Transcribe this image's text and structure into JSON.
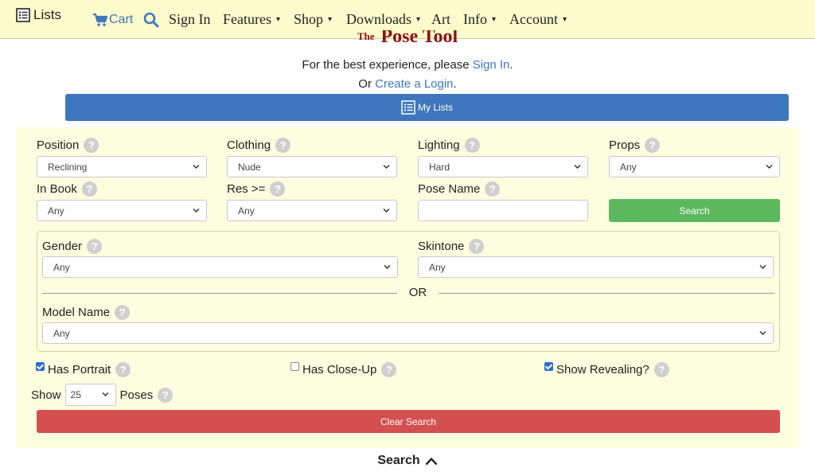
{
  "nav": {
    "lists_label": "Lists",
    "cart_label": "Cart",
    "signin_label": "Sign In",
    "features_label": "Features",
    "shop_label": "Shop",
    "downloads_label": "Downloads",
    "art_label": "Art",
    "info_label": "Info",
    "account_label": "Account",
    "caret": "▾"
  },
  "header": {
    "logo_prefix": "The",
    "logo_title": "Pose Tool",
    "signin_prefix": "For the best experience, please ",
    "signin_link": "Sign In",
    "signin_suffix": ".",
    "login_prefix": "Or ",
    "login_link": "Create a Login",
    "login_suffix": "."
  },
  "mylists_button": "My Lists",
  "help_glyph": "?",
  "filters": {
    "position": {
      "label": "Position",
      "value": "Reclining"
    },
    "clothing": {
      "label": "Clothing",
      "value": "Nude"
    },
    "lighting": {
      "label": "Lighting",
      "value": "Hard"
    },
    "props": {
      "label": "Props",
      "value": "Any"
    },
    "in_book": {
      "label": "In Book",
      "value": "Any"
    },
    "res": {
      "label": "Res >=",
      "value": "Any"
    },
    "pose_name": {
      "label": "Pose Name",
      "value": ""
    },
    "search_button": "Search",
    "gender": {
      "label": "Gender",
      "value": "Any"
    },
    "skintone": {
      "label": "Skintone",
      "value": "Any"
    },
    "or_label": "OR",
    "model_name": {
      "label": "Model Name",
      "value": "Any"
    },
    "has_portrait": {
      "label": "Has Portrait",
      "checked": true
    },
    "has_closeup": {
      "label": "Has Close-Up",
      "checked": false
    },
    "show_revealing": {
      "label": "Show Revealing?",
      "checked": true
    },
    "show_label": "Show",
    "show_value": "25",
    "poses_label": "Poses",
    "clear_button": "Clear Search"
  },
  "search_toggle": "Search",
  "colors": {
    "navbar_bg": "#fdfccd",
    "panel_bg": "#fdfde0",
    "primary_blue": "#3e77bd",
    "search_green": "#5cb85c",
    "clear_red": "#d45050",
    "logo_red": "#8b1212"
  }
}
